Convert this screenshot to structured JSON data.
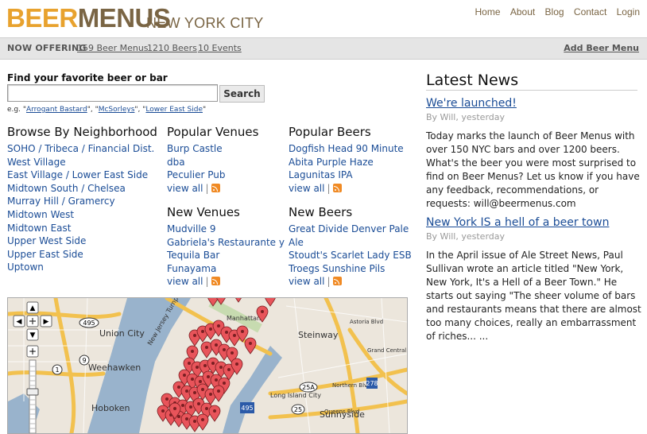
{
  "header": {
    "logo_part1": "BEER",
    "logo_part2": "MENUS",
    "city": "NEW YORK CITY",
    "nav": [
      "Home",
      "About",
      "Blog",
      "Contact",
      "Login"
    ]
  },
  "offering": {
    "label": "NOW OFFERING",
    "beer_menus": "159 Beer Menus",
    "beers": "1210 Beers",
    "events": "10 Events",
    "add_menu": "Add Beer Menu"
  },
  "search": {
    "label": "Find your favorite beer or bar",
    "value": "",
    "button": "Search",
    "example_prefix": "e.g. ",
    "examples": [
      "Arrogant Bastard",
      "McSorleys",
      "Lower East Side"
    ]
  },
  "browse": {
    "title": "Browse By Neighborhood",
    "items": [
      "SOHO / Tribeca / Financial Dist.",
      "West Village",
      "East Village / Lower East Side",
      "Midtown South / Chelsea",
      "Murray Hill / Gramercy",
      "Midtown West",
      "Midtown East",
      "Upper West Side",
      "Upper East Side",
      "Uptown"
    ]
  },
  "popular_venues": {
    "title": "Popular Venues",
    "items": [
      "Burp Castle",
      "dba",
      "Peculier Pub"
    ],
    "view_all": "view all"
  },
  "new_venues": {
    "title": "New Venues",
    "items": [
      "Mudville 9",
      "Gabriela's Restaurante y",
      "Tequila Bar",
      "Funayama"
    ],
    "view_all": "view all"
  },
  "popular_beers": {
    "title": "Popular Beers",
    "items": [
      "Dogfish Head 90 Minute",
      "Abita Purple Haze",
      "Lagunitas IPA"
    ],
    "view_all": "view all"
  },
  "new_beers": {
    "title": "New Beers",
    "items": [
      "Great Divide Denver Pale",
      "Ale",
      "Stoudt's Scarlet Lady ESB",
      "Troegs Sunshine Pils"
    ],
    "view_all": "view all"
  },
  "map": {
    "labels": [
      "Union City",
      "Weehawken",
      "Manhattan",
      "Steinway",
      "Hoboken",
      "Long Island City",
      "Sunnyside",
      "Northern Blvd",
      "Grand Central",
      "Queens Blvd",
      "Astoria Blvd",
      "New Jersey Turnpike"
    ],
    "shields": [
      "495",
      "9",
      "1",
      "278",
      "25A",
      "25",
      "495"
    ],
    "controls": [
      "▲",
      "◀",
      "▶",
      "▼",
      "+",
      "−"
    ]
  },
  "news": {
    "title": "Latest News",
    "items": [
      {
        "headline": "We're launched!",
        "meta": "By Will, yesterday",
        "body": "Today marks the launch of Beer Menus with over 150 NYC bars and over 1200 beers. What's the beer you were most surprised to find on Beer Menus? Let us know if you have any feedback, recommendations, or requests: will@beermenus.com"
      },
      {
        "headline": "New York IS a hell of a beer town",
        "meta": "By Will, yesterday",
        "body": "In the April issue of Ale Street News, Paul Sullivan wrote an article titled \"New York, New York, It's a Hell of a Beer Town.\" He starts out saying \"The sheer volume of bars and restaurants means that there are almost too many choices, really an embarrassment of riches... ..."
      }
    ]
  },
  "colors": {
    "brand_orange": "#e8a22e",
    "brand_brown": "#7a6544",
    "link": "#1a4c96",
    "pin": "#e8545a"
  }
}
